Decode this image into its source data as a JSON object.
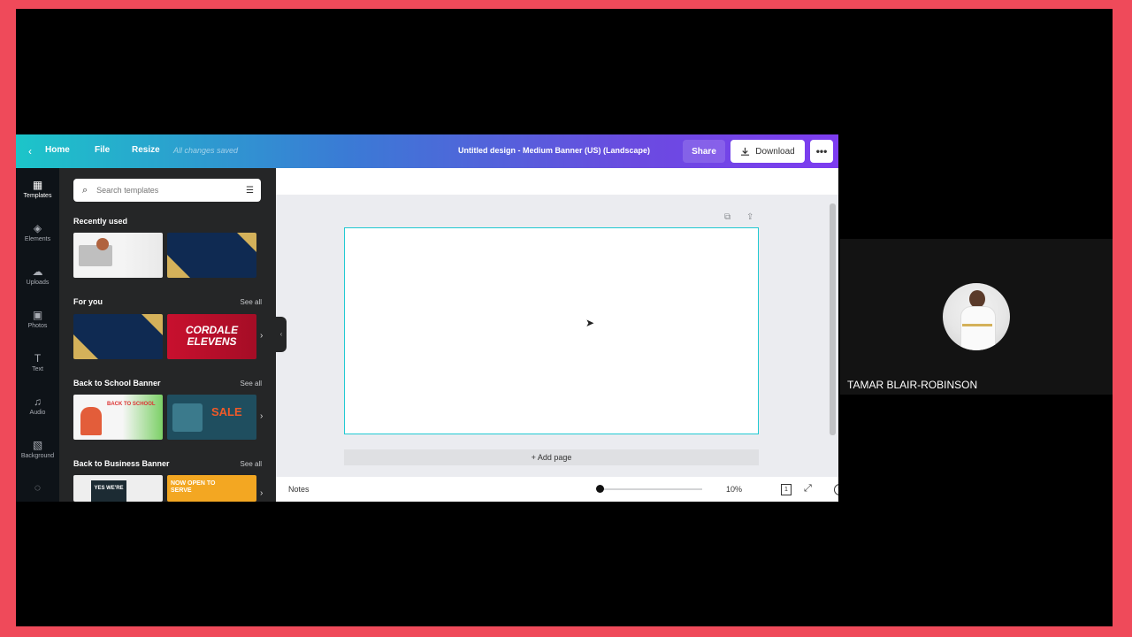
{
  "topbar": {
    "home": "Home",
    "file": "File",
    "resize": "Resize",
    "saved": "All changes saved",
    "title": "Untitled design - Medium Banner (US) (Landscape)",
    "share": "Share",
    "download": "Download",
    "more": "•••"
  },
  "rail": [
    {
      "label": "Templates",
      "icon": "▦"
    },
    {
      "label": "Elements",
      "icon": "◈"
    },
    {
      "label": "Uploads",
      "icon": "☁"
    },
    {
      "label": "Photos",
      "icon": "▣"
    },
    {
      "label": "Text",
      "icon": "T"
    },
    {
      "label": "Audio",
      "icon": "♫"
    },
    {
      "label": "Background",
      "icon": "▧"
    }
  ],
  "panel": {
    "search_placeholder": "Search templates",
    "sections": [
      {
        "title": "Recently used",
        "see_all": ""
      },
      {
        "title": "For you",
        "see_all": "See all"
      },
      {
        "title": "Back to School Banner",
        "see_all": "See all"
      },
      {
        "title": "Back to Business Banner",
        "see_all": "See all"
      }
    ],
    "thumbs": {
      "cordale": "CORDALE ELEVENS",
      "back_to_school": "BACK TO SCHOOL",
      "sale": "SALE",
      "now_open": "NOW OPEN TO SERVE",
      "yes_were": "YES WE'RE"
    }
  },
  "editor": {
    "add_page": "+ Add page"
  },
  "bottombar": {
    "notes": "Notes",
    "zoom": "10%",
    "page_count": "1",
    "help": "?"
  },
  "participant": {
    "name": "TAMAR BLAIR-ROBINSON"
  },
  "colors": {
    "outer": "#ef4a5a",
    "accent_start": "#1cc5c9",
    "accent_end": "#7d3cf0",
    "artboard_border": "#20c9d2"
  }
}
